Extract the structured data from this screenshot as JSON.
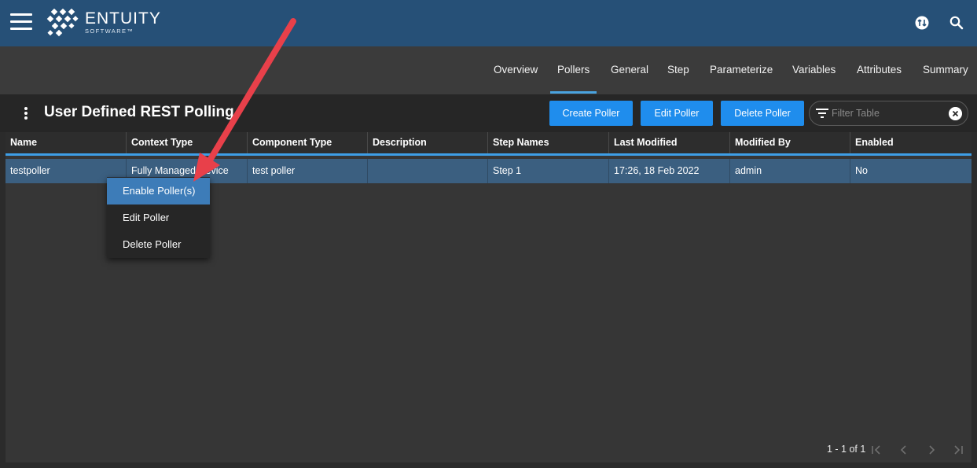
{
  "header": {
    "logo_text": "ENTUITY",
    "logo_sub": "SOFTWARE™",
    "accent": "#265077"
  },
  "tabs": [
    {
      "label": "Overview",
      "active": false
    },
    {
      "label": "Pollers",
      "active": true
    },
    {
      "label": "General",
      "active": false
    },
    {
      "label": "Step",
      "active": false
    },
    {
      "label": "Parameterize",
      "active": false
    },
    {
      "label": "Variables",
      "active": false
    },
    {
      "label": "Attributes",
      "active": false
    },
    {
      "label": "Summary",
      "active": false
    }
  ],
  "toolbar": {
    "title": "User Defined REST Polling",
    "create_label": "Create Poller",
    "edit_label": "Edit Poller",
    "delete_label": "Delete Poller",
    "filter_placeholder": "Filter Table",
    "button_color": "#1f8ded"
  },
  "table": {
    "columns": [
      "Name",
      "Context Type",
      "Component Type",
      "Description",
      "Step Names",
      "Last Modified",
      "Modified By",
      "Enabled"
    ],
    "rows": [
      [
        "testpoller",
        "Fully Managed Device",
        "test poller",
        "",
        "Step 1",
        "17:26, 18 Feb 2022",
        "admin",
        "No"
      ]
    ]
  },
  "context_menu": {
    "items": [
      {
        "label": "Enable Poller(s)",
        "highlighted": true
      },
      {
        "label": "Edit Poller",
        "highlighted": false
      },
      {
        "label": "Delete Poller",
        "highlighted": false
      }
    ]
  },
  "pagination": {
    "range_text": "1 - 1 of 1"
  },
  "annotation": {
    "arrow_color": "#e8404a"
  }
}
